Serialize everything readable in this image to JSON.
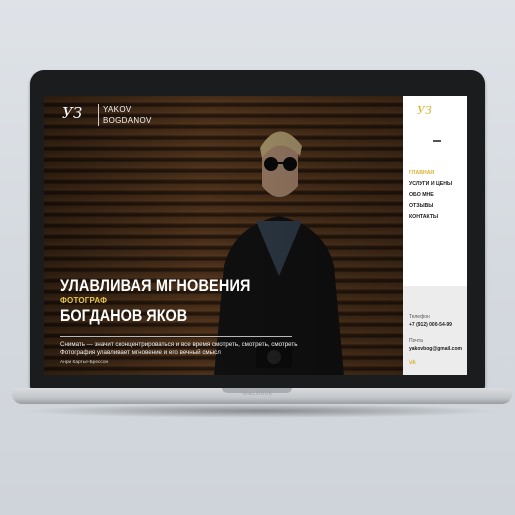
{
  "header": {
    "logo_text": "УЗ",
    "brand_line1": "YAKOV",
    "brand_line2": "BOGDANOV"
  },
  "hero": {
    "headline": "УЛАВЛИВАЯ МГНОВЕНИЯ",
    "role": "ФОТОГРАФ",
    "name": "БОГДАНОВ ЯКОВ",
    "quote_line1": "Снимать — значит сконцентрироваться и все время смотреть, смотреть, смотреть",
    "quote_line2": "Фотография улавливает мгновение и его вечный смысл",
    "quote_author": "Анри Картье-Брессон"
  },
  "sidebar": {
    "logo_text": "УЗ",
    "nav": [
      {
        "label": "ГЛАВНАЯ",
        "active": true
      },
      {
        "label": "УСЛУГИ И ЦЕНЫ",
        "active": false
      },
      {
        "label": "ОБО МНЕ",
        "active": false
      },
      {
        "label": "ОТЗЫВЫ",
        "active": false
      },
      {
        "label": "КОНТАКТЫ",
        "active": false
      }
    ],
    "phone_label": "Телефон",
    "phone_value": "+7 (912) 000-54-99",
    "email_label": "Почта",
    "email_value": "yakovbog@gmail.com",
    "social": "vk"
  },
  "device": {
    "label": "MacBook"
  },
  "colors": {
    "accent": "#d8b233",
    "sidebar_bg": "#ffffff",
    "contacts_bg": "#ececec"
  }
}
